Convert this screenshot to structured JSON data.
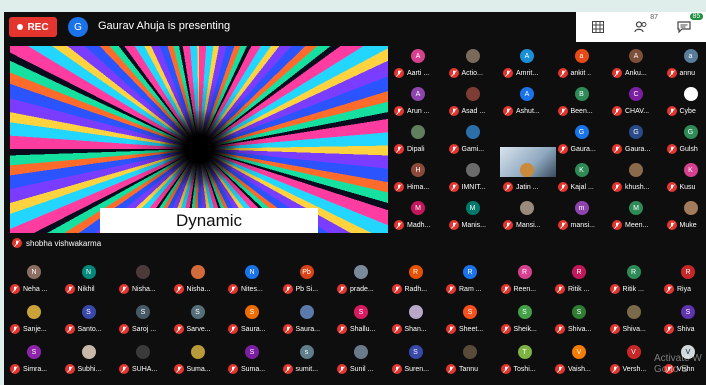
{
  "topbar": {
    "rec_label": "REC",
    "presenter_initial": "G",
    "presenter_text": "Gaurav Ahuja is presenting",
    "participants_count": "87",
    "chat_count": "85"
  },
  "share": {
    "caption": "Dynamic",
    "presenter_name": "shobha vishwakarma"
  },
  "colors": {
    "rec": "#e3352e",
    "mic_off": "#e3352e",
    "zoom_blue": "#1a73e8",
    "chat_badge": "#1e8e3e"
  },
  "watermark": {
    "line1": "Activate W",
    "line2": "Go to S"
  },
  "grid_right": [
    [
      {
        "n": "Aarti ...",
        "i": "A",
        "c": "#d6418f"
      },
      {
        "n": "Actio...",
        "i": "",
        "c": "#7a6a5a"
      },
      {
        "n": "Amrit...",
        "i": "A",
        "c": "#1a8fd6"
      },
      {
        "n": "ankit ..",
        "i": "a",
        "c": "#e64a19"
      },
      {
        "n": "Anku...",
        "i": "A",
        "c": "#7d4e38"
      },
      {
        "n": "annu",
        "i": "a",
        "c": "#5a7d9a"
      }
    ],
    [
      {
        "n": "Arun ...",
        "i": "A",
        "c": "#8e44ad"
      },
      {
        "n": "Asad ...",
        "i": "",
        "c": "#7d3c34"
      },
      {
        "n": "Ashut...",
        "i": "A",
        "c": "#1a73e8"
      },
      {
        "n": "Been...",
        "i": "B",
        "c": "#2e8b57"
      },
      {
        "n": "CHAV...",
        "i": "C",
        "c": "#7b1fa2"
      },
      {
        "n": "Cybe",
        "i": "",
        "c": "#ffffff"
      }
    ],
    [
      {
        "n": "Dipali",
        "i": "",
        "c": "#5f7f5f"
      },
      {
        "n": "Gami...",
        "i": "",
        "c": "#2c6ea8"
      },
      {
        "n": "",
        "i": "",
        "c": ""
      },
      {
        "n": "Gaura...",
        "i": "G",
        "c": "#1a73e8"
      },
      {
        "n": "Gaura...",
        "i": "G",
        "c": "#2b4a8a"
      },
      {
        "n": "Gulsh",
        "i": "G",
        "c": "#2e8b57"
      }
    ],
    [
      {
        "n": "Hima...",
        "i": "H",
        "c": "#8d4a3a"
      },
      {
        "n": "IMNIT...",
        "i": "",
        "c": "#6b6b6b"
      },
      {
        "n": "Jatin ...",
        "i": "",
        "c": "#c98a3a"
      },
      {
        "n": "Kajal ...",
        "i": "K",
        "c": "#2e8b57"
      },
      {
        "n": "khush...",
        "i": "",
        "c": "#8a6a4a"
      },
      {
        "n": "Kusu",
        "i": "K",
        "c": "#d6418f"
      }
    ],
    [
      {
        "n": "Madh...",
        "i": "M",
        "c": "#c2185b"
      },
      {
        "n": "Manis...",
        "i": "M",
        "c": "#00796b"
      },
      {
        "n": "Mansi...",
        "i": "",
        "c": "#9a8a7a"
      },
      {
        "n": "mansi...",
        "i": "m",
        "c": "#8e44ad"
      },
      {
        "n": "Meen...",
        "i": "M",
        "c": "#2e8b57"
      },
      {
        "n": "Muke",
        "i": "",
        "c": "#a37a5a"
      }
    ]
  ],
  "grid_bottom": [
    [
      {
        "n": "Neha ...",
        "i": "N",
        "c": "#8d6e63"
      },
      {
        "n": "Nikhil",
        "i": "N",
        "c": "#00897b"
      },
      {
        "n": "Nisha...",
        "i": "",
        "c": "#4a3a3a"
      },
      {
        "n": "Nisha...",
        "i": "",
        "c": "#d26a3a"
      },
      {
        "n": "Nites...",
        "i": "N",
        "c": "#1a73e8"
      },
      {
        "n": "Pb Si...",
        "i": "Pb",
        "c": "#d84315"
      },
      {
        "n": "prade...",
        "i": "",
        "c": "#7a8a9a"
      },
      {
        "n": "Radh...",
        "i": "R",
        "c": "#e65100"
      },
      {
        "n": "Ram ...",
        "i": "R",
        "c": "#1a73e8"
      },
      {
        "n": "Reen...",
        "i": "R",
        "c": "#d6418f"
      },
      {
        "n": "Ritik ...",
        "i": "R",
        "c": "#c2185b"
      },
      {
        "n": "Ritik ...",
        "i": "R",
        "c": "#2e8b57"
      },
      {
        "n": "Riya",
        "i": "R",
        "c": "#c62828"
      }
    ],
    [
      {
        "n": "Sanje...",
        "i": "",
        "c": "#c9a23a"
      },
      {
        "n": "Santo...",
        "i": "S",
        "c": "#3949ab"
      },
      {
        "n": "Saroj ...",
        "i": "S",
        "c": "#455a64"
      },
      {
        "n": "Sarve...",
        "i": "S",
        "c": "#546e7a"
      },
      {
        "n": "Saura...",
        "i": "S",
        "c": "#ef6c00"
      },
      {
        "n": "Saura...",
        "i": "",
        "c": "#5a7aaa"
      },
      {
        "n": "Shallu...",
        "i": "S",
        "c": "#d81b60"
      },
      {
        "n": "Shan...",
        "i": "",
        "c": "#b8a8c8"
      },
      {
        "n": "Sheet...",
        "i": "S",
        "c": "#f4511e"
      },
      {
        "n": "Sheik...",
        "i": "S",
        "c": "#43a047"
      },
      {
        "n": "Shiva...",
        "i": "S",
        "c": "#2e7d32"
      },
      {
        "n": "Shiva...",
        "i": "",
        "c": "#7a6a4a"
      },
      {
        "n": "Shiva",
        "i": "S",
        "c": "#5e35b1"
      }
    ],
    [
      {
        "n": "Simra...",
        "i": "S",
        "c": "#8e24aa"
      },
      {
        "n": "Subhi...",
        "i": "",
        "c": "#c8b8a8"
      },
      {
        "n": "SUHA...",
        "i": "",
        "c": "#3a3a3a"
      },
      {
        "n": "Suma...",
        "i": "",
        "c": "#b89a3a"
      },
      {
        "n": "Suma...",
        "i": "S",
        "c": "#7b1fa2"
      },
      {
        "n": "sumit...",
        "i": "s",
        "c": "#607d8b"
      },
      {
        "n": "Sunil ...",
        "i": "",
        "c": "#6a7a8a"
      },
      {
        "n": "Suren...",
        "i": "S",
        "c": "#3949ab"
      },
      {
        "n": "Tannu",
        "i": "",
        "c": "#5a4a3a"
      },
      {
        "n": "Toshi...",
        "i": "T",
        "c": "#7cb342"
      },
      {
        "n": "Vaish...",
        "i": "V",
        "c": "#f57c00"
      },
      {
        "n": "Versh...",
        "i": "V",
        "c": "#c62828"
      },
      {
        "n": "Vishn",
        "i": "V",
        "c": "#cfd8dc"
      }
    ]
  ]
}
